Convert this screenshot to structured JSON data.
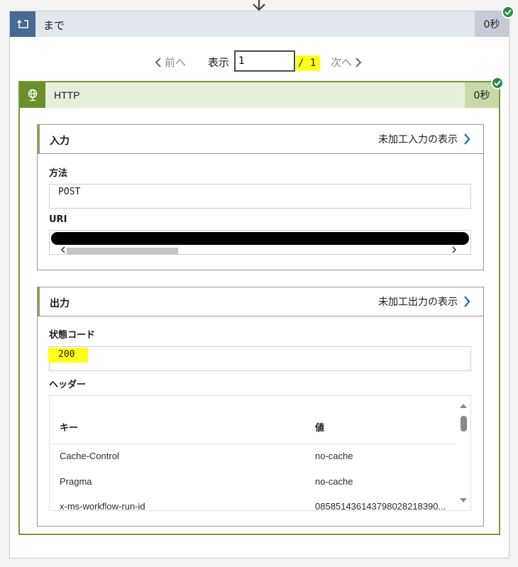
{
  "until": {
    "title": "まで",
    "duration": "0秒",
    "status": "succeeded"
  },
  "pager": {
    "prev_label": "前へ",
    "show_label": "表示",
    "current_page": "1",
    "total_label": "/ 1",
    "next_label": "次へ"
  },
  "http": {
    "title": "HTTP",
    "duration": "0秒",
    "status": "succeeded",
    "inputs": {
      "title": "入力",
      "raw_link": "未加工入力の表示",
      "method_label": "方法",
      "method_value": "POST",
      "uri_label": "URI"
    },
    "outputs": {
      "title": "出力",
      "raw_link": "未加工出力の表示",
      "status_code_label": "状態コード",
      "status_code_value": "200",
      "headers_label": "ヘッダー",
      "headers_table": {
        "columns": [
          "キー",
          "値"
        ],
        "rows": [
          [
            "Cache-Control",
            "no-cache"
          ],
          [
            "Pragma",
            "no-cache"
          ],
          [
            "x-ms-workflow-run-id",
            "085851436143798028218390..."
          ]
        ]
      }
    }
  },
  "colors": {
    "until_accent": "#486991",
    "http_accent": "#6a8f2c",
    "highlight": "#ffff1a",
    "success": "#2a8a3e",
    "link_chevron": "#1f6fbf"
  }
}
